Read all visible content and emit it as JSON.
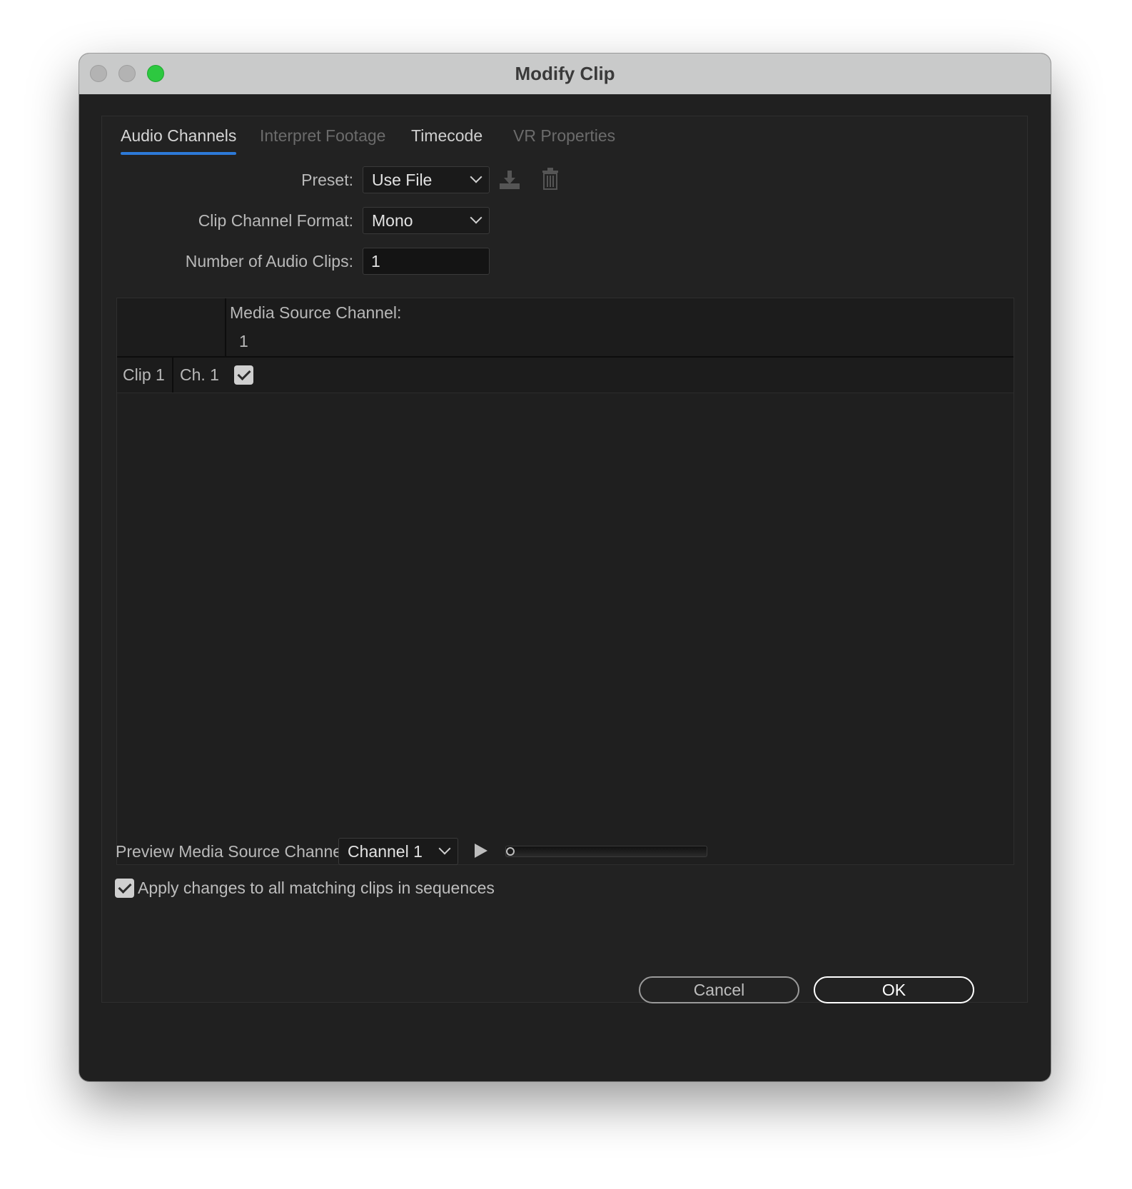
{
  "window": {
    "title": "Modify Clip"
  },
  "tabs": [
    {
      "label": "Audio Channels",
      "state": "active"
    },
    {
      "label": "Interpret Footage",
      "state": "disabled"
    },
    {
      "label": "Timecode",
      "state": "normal"
    },
    {
      "label": "VR Properties",
      "state": "disabled"
    }
  ],
  "form": {
    "preset_label": "Preset:",
    "preset_value": "Use File",
    "format_label": "Clip Channel Format:",
    "format_value": "Mono",
    "num_clips_label": "Number of Audio Clips:",
    "num_clips_value": "1"
  },
  "matrix": {
    "header_label": "Media Source Channel:",
    "source_channels": [
      "1"
    ],
    "rows": [
      {
        "clip": "Clip 1",
        "channel": "Ch. 1",
        "assigned": [
          true
        ]
      }
    ]
  },
  "preview": {
    "label": "Preview Media Source Channel:",
    "channel_value": "Channel 1",
    "position": 0
  },
  "apply_all": {
    "label": "Apply changes to all matching clips in sequences",
    "checked": true
  },
  "buttons": {
    "cancel": "Cancel",
    "ok": "OK"
  },
  "icons": {
    "save_preset": "save-preset-icon",
    "delete_preset": "trash-icon"
  },
  "colors": {
    "accent": "#2d7ad8",
    "zoom_light": "#2dc840",
    "dialog_bg": "#202020"
  }
}
